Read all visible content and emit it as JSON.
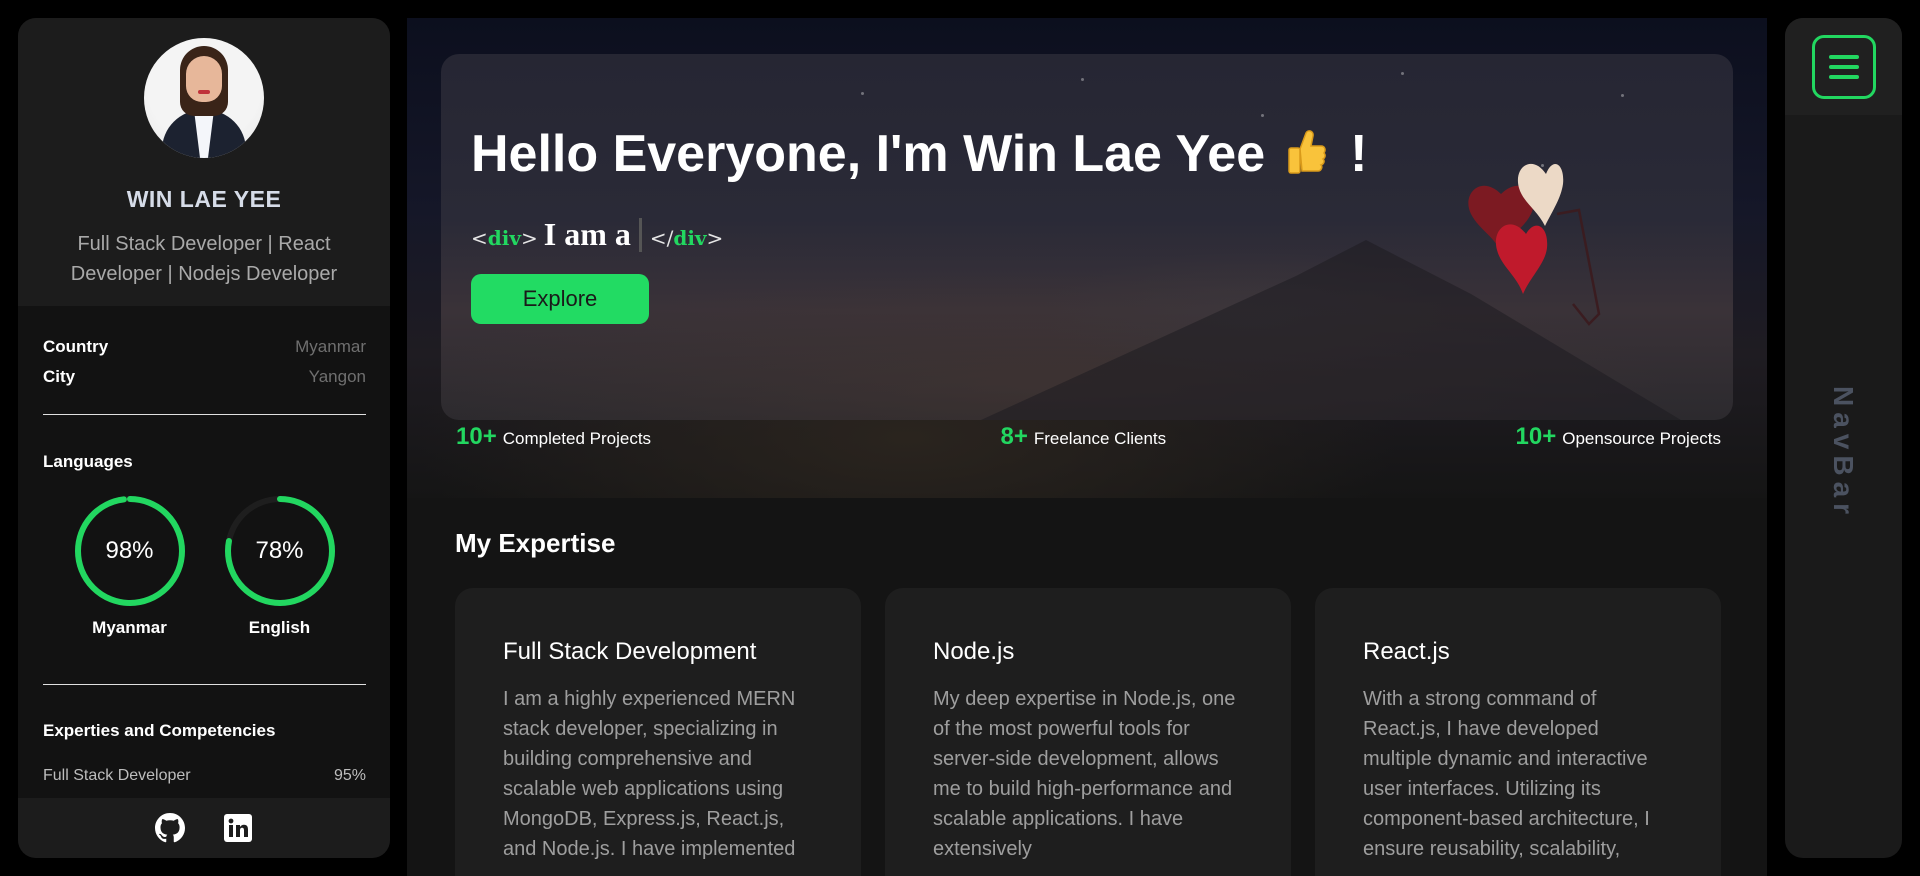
{
  "profile": {
    "name": "WIN LAE YEE",
    "role": "Full Stack Developer | React Developer | Nodejs Developer",
    "info": [
      {
        "key": "Country",
        "value": "Myanmar"
      },
      {
        "key": "City",
        "value": "Yangon"
      }
    ],
    "languages_title": "Languages",
    "languages": [
      {
        "name": "Myanmar",
        "percent_label": "98%",
        "percent": 98
      },
      {
        "name": "English",
        "percent_label": "78%",
        "percent": 78
      }
    ],
    "skills_title": "Experties and Competencies",
    "skills": [
      {
        "name": "Full Stack Developer",
        "percent_label": "95%"
      }
    ],
    "social": [
      {
        "icon": "github-icon"
      },
      {
        "icon": "linkedin-icon"
      }
    ]
  },
  "hero": {
    "greeting": "Hello Everyone, I'm Win Lae Yee",
    "emoji_icon": "thumbs-up-icon",
    "exclaim": "!",
    "tag_open": "<",
    "tag_name": "div",
    "tag_close": ">",
    "tag_end_open": "</",
    "typing_text": "I am a",
    "explore_label": "Explore"
  },
  "stats": [
    {
      "num": "10+",
      "label": "Completed Projects"
    },
    {
      "num": "8+",
      "label": "Freelance Clients"
    },
    {
      "num": "10+",
      "label": "Opensource Projects"
    }
  ],
  "expertise": {
    "title": "My Expertise",
    "cards": [
      {
        "title": "Full Stack Development",
        "body": "I am a highly experienced MERN stack developer, specializing in building comprehensive and scalable web applications using MongoDB, Express.js, React.js, and Node.js. I have implemented"
      },
      {
        "title": "Node.js",
        "body": "My deep expertise in Node.js, one of the most powerful tools for server-side development, allows me to build high-performance and scalable applications. I have extensively"
      },
      {
        "title": "React.js",
        "body": "With a strong command of React.js, I have developed multiple dynamic and interactive user interfaces. Utilizing its component-based architecture, I ensure reusability, scalability,"
      }
    ]
  },
  "navbar": {
    "label": "NavBar",
    "menu_icon": "hamburger-menu-icon"
  },
  "colors": {
    "accent": "#22d760",
    "sidebar_bg": "#121212",
    "card_bg": "#1e1e1e"
  }
}
